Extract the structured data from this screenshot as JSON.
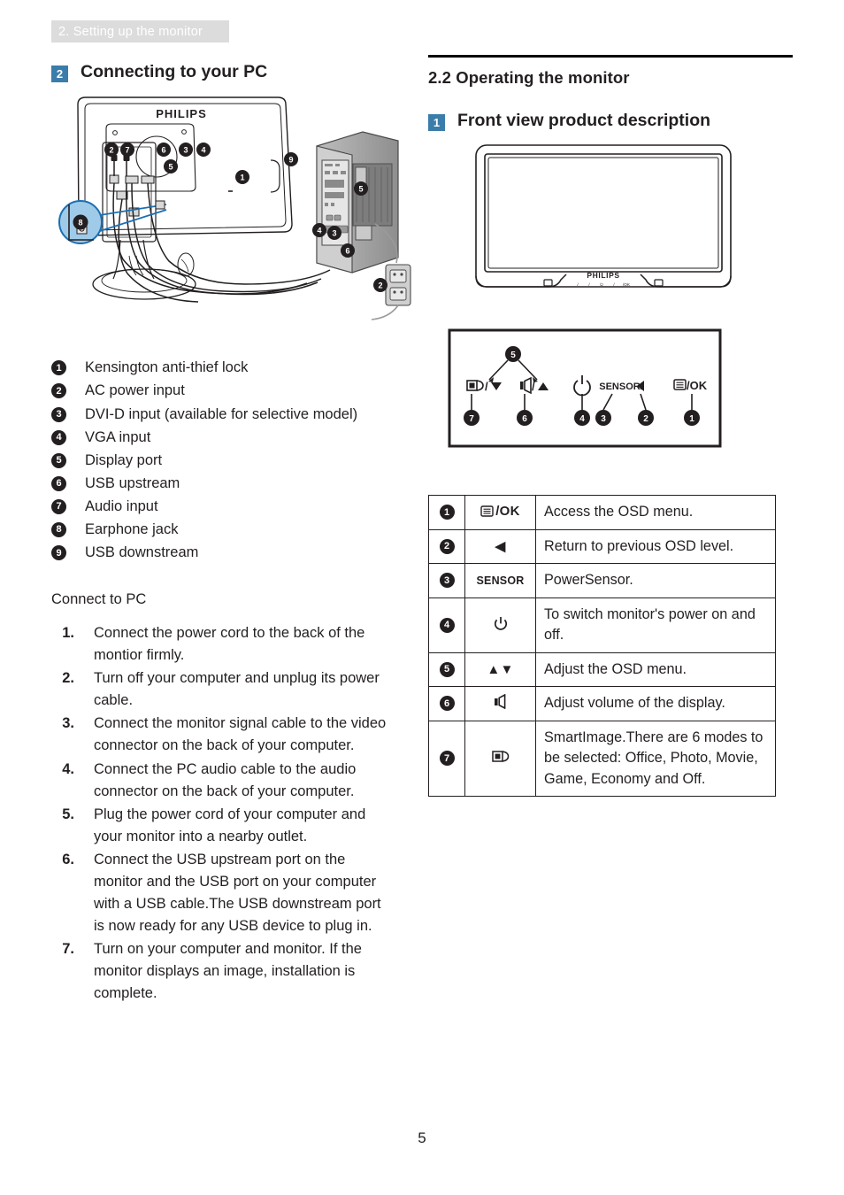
{
  "running_header": "2. Setting up the monitor",
  "left": {
    "section": {
      "badge": "2",
      "title": "Connecting to your PC"
    },
    "diagram": {
      "brand": "PHILIPS",
      "callout_numbers": [
        "1",
        "2",
        "3",
        "4",
        "5",
        "6",
        "7",
        "8",
        "9"
      ]
    },
    "legend": [
      {
        "num": "1",
        "text": "Kensington anti-thief lock"
      },
      {
        "num": "2",
        "text": "AC power input"
      },
      {
        "num": "3",
        "text": "DVI-D input (available for selective model)"
      },
      {
        "num": "4",
        "text": "VGA input"
      },
      {
        "num": "5",
        "text": "Display port"
      },
      {
        "num": "6",
        "text": "USB upstream"
      },
      {
        "num": "7",
        "text": "Audio input"
      },
      {
        "num": "8",
        "text": "Earphone jack"
      },
      {
        "num": "9",
        "text": "USB downstream"
      }
    ],
    "connect_title": "Connect to PC",
    "steps": [
      {
        "num": "1.",
        "text": "Connect the power cord to the back of the montior firmly."
      },
      {
        "num": "2.",
        "text": "Turn off your computer and unplug its power cable."
      },
      {
        "num": "3.",
        "text": "Connect the monitor signal cable to the video connector on the back of your computer."
      },
      {
        "num": "4.",
        "text": "Connect the PC audio cable to the audio connector on the back of your computer."
      },
      {
        "num": "5.",
        "text": "Plug the power cord of your computer and your monitor into a nearby outlet."
      },
      {
        "num": "6.",
        "text": "Connect the USB upstream port on the monitor and the USB port on your computer with a USB cable.The USB downstream port is now ready for any USB device to plug in."
      },
      {
        "num": "7.",
        "text": "Turn on your computer and monitor. If the monitor displays an image, installation is complete."
      }
    ]
  },
  "right": {
    "h2": "2.2 Operating the monitor",
    "section": {
      "badge": "1",
      "title": "Front view product description"
    },
    "frontview": {
      "brand": "PHILIPS"
    },
    "control_panel": {
      "labels": [
        "7",
        "6",
        "4",
        "3",
        "2",
        "1"
      ],
      "top_label": "5",
      "glyph_smartimage": "/",
      "glyph_volume": "/",
      "glyph_power": "power",
      "glyph_sensor": "SENSOR/",
      "glyph_osd": "/OK"
    },
    "table": {
      "rows": [
        {
          "num": "1",
          "icon": "osd-ok",
          "icon_text": "/OK",
          "desc": "Access the OSD menu."
        },
        {
          "num": "2",
          "icon": "left-triangle",
          "icon_text": "◀",
          "desc": "Return to previous OSD level."
        },
        {
          "num": "3",
          "icon": "sensor",
          "icon_text": "SENSOR",
          "desc": "PowerSensor."
        },
        {
          "num": "4",
          "icon": "power",
          "icon_text": "⏻",
          "desc": "To switch monitor's power on and off."
        },
        {
          "num": "5",
          "icon": "up-down-triangle",
          "icon_text": "▲▼",
          "desc": "Adjust the OSD menu."
        },
        {
          "num": "6",
          "icon": "volume",
          "icon_text": "volume",
          "desc": "Adjust volume of the display."
        },
        {
          "num": "7",
          "icon": "smartimage",
          "icon_text": "smartimage",
          "desc": "SmartImage.There are 6 modes to be selected: Office, Photo, Movie, Game, Economy and Off."
        }
      ]
    }
  },
  "page_number": "5",
  "colors": {
    "accent_blue": "#3b7daa",
    "header_band": "#dcdcdc",
    "text": "#231f20"
  }
}
